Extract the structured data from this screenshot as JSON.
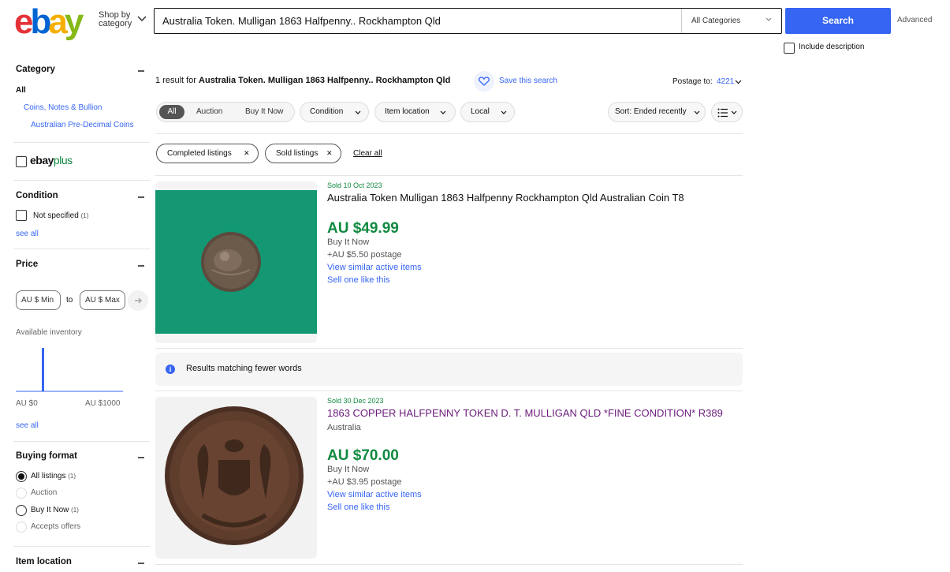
{
  "header": {
    "logo": {
      "letters": [
        "e",
        "b",
        "a",
        "y"
      ],
      "colors": [
        "#e53238",
        "#0064d2",
        "#f5af02",
        "#86b817"
      ]
    },
    "shop_by_line1": "Shop by",
    "shop_by_line2": "category",
    "search_value": "Australia Token. Mulligan 1863 Halfpenny.. Rockhampton Qld",
    "category_select": "All Categories",
    "search_button": "Search",
    "advanced": "Advanced",
    "include_description": "Include description"
  },
  "sidebar": {
    "category_heading": "Category",
    "category_all": "All",
    "category_items": [
      "Coins, Notes & Bullion",
      "Australian Pre-Decimal Coins"
    ],
    "ebayplus_a": "ebay",
    "ebayplus_b": "plus",
    "condition_heading": "Condition",
    "condition_option": "Not specified",
    "condition_count": "(1)",
    "see_all": "see all",
    "price_heading": "Price",
    "price_min": "AU $ Min",
    "price_to": "to",
    "price_max": "AU $ Max",
    "available_inventory": "Available inventory",
    "range_min": "AU $0",
    "range_max": "AU $1000",
    "inventory_bar_fraction": 0.05,
    "buying_format_heading": "Buying format",
    "buying_format_options": [
      {
        "label": "All listings",
        "count": "(1)",
        "selected": true
      },
      {
        "label": "Auction",
        "count": "",
        "selected": false
      },
      {
        "label": "Buy It Now",
        "count": "(1)",
        "selected": false
      },
      {
        "label": "Accepts offers",
        "count": "",
        "selected": false
      }
    ],
    "item_location_heading": "Item location"
  },
  "results": {
    "count_prefix": "1 result for ",
    "query": "Australia Token. Mulligan 1863 Halfpenny.. Rockhampton Qld",
    "save_search": "Save this search",
    "postage_to_label": "Postage to:",
    "postage_to_value": "4221",
    "segments": [
      "All",
      "Auction",
      "Buy It Now"
    ],
    "filters": [
      "Condition",
      "Item location",
      "Local"
    ],
    "sort": "Sort: Ended recently",
    "active_chips": [
      "Completed listings",
      "Sold listings"
    ],
    "clear_all": "Clear all",
    "fewer_words_notice": "Results matching fewer words",
    "items": [
      {
        "sold_date": "Sold 10 Oct 2023",
        "title": "Australia Token Mulligan 1863 Halfpenny Rockhampton Qld Australian Coin T8",
        "subtitle": "",
        "price": "AU $49.99",
        "format": "Buy It Now",
        "postage": "+AU $5.50 postage",
        "similar": "View similar active items",
        "sell": "Sell one like this"
      },
      {
        "sold_date": "Sold 30 Dec 2023",
        "title": "1863 COPPER HALFPENNY TOKEN D. T. MULLIGAN QLD *FINE CONDITION* R389",
        "subtitle": "Australia",
        "price": "AU $70.00",
        "format": "Buy It Now",
        "postage": "+AU $3.95 postage",
        "similar": "View similar active items",
        "sell": "Sell one like this"
      }
    ]
  },
  "colors": {
    "accent": "#3665f3",
    "sold_green": "#118a40",
    "visited": "#6b1a7b"
  }
}
